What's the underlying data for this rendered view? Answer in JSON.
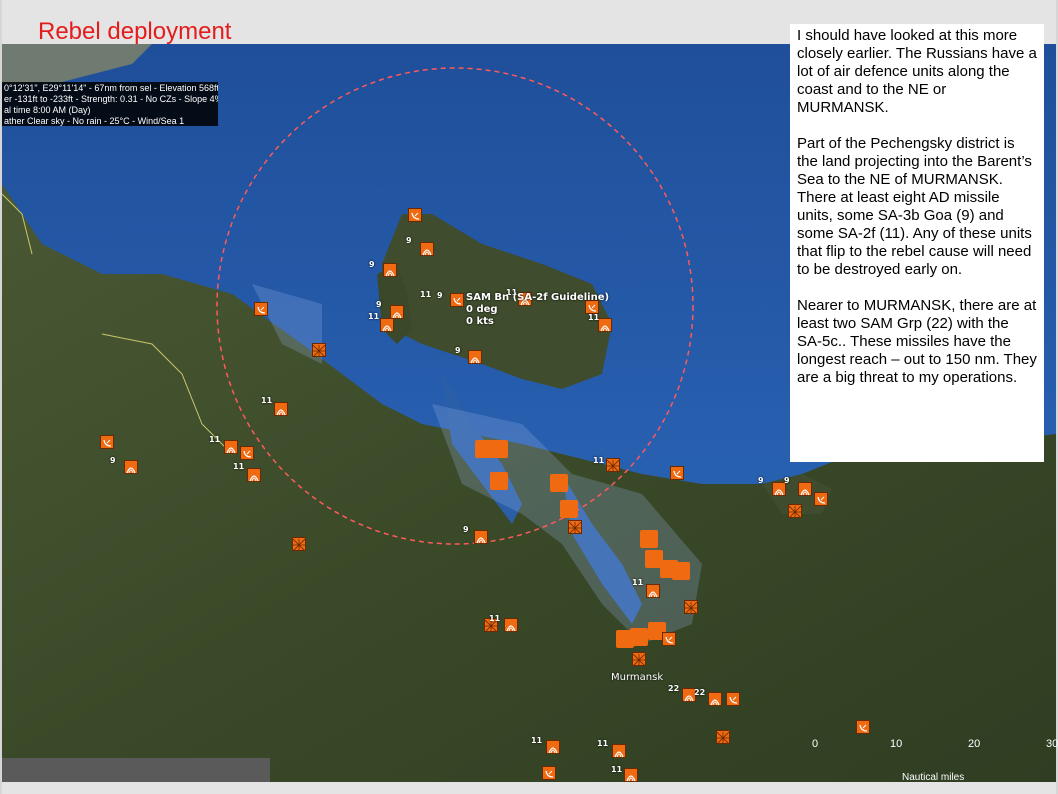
{
  "slide": {
    "title": "Rebel deployment",
    "title_color": "#e51c1c"
  },
  "info_panel": {
    "line1": "0°12'31\", E29°11'14\" - 67nm from sel - Elevation 568ft",
    "line2": "er -131ft to -233ft - Strength: 0.31 - No CZs - Slope 4%",
    "line3": "al time 8:00 AM (Day)",
    "line4": "ather Clear sky - No rain - 25°C - Wind/Sea 1"
  },
  "note": {
    "p1": "I should have looked at this more closely earlier.  The Russians have a lot of air defence units along the coast and to the NE or MURMANSK.",
    "p2": "Part of the Pechengsky district is the land projecting into the Barent’s Sea to the NE of MURMANSK.  There at least eight AD missile units, some SA-3b Goa (9) and some SA-2f (11).  Any of these units that flip to the rebel cause will need to be destroyed early on.",
    "p3": "Nearer to MURMANSK, there are at least two SAM Grp (22) with the SA-5c..  These missiles have the longest reach – out to 150 nm.  They are a big threat to my operations."
  },
  "selected_unit": {
    "name": "SAM Bn (SA-2f Guideline)",
    "heading": "0 deg",
    "speed": "0 kts"
  },
  "map": {
    "city_label": "Murmansk",
    "unit_color": "#f06a12",
    "range_ring_color": "#ff5a5a",
    "sea_color": "#2a5fa8",
    "land_color": "#3d4a2b",
    "unit_labels": [
      "9",
      "9",
      "9",
      "11",
      "9",
      "11",
      "11",
      "9",
      "11",
      "11",
      "9",
      "11",
      "9",
      "11",
      "9",
      "9",
      "11",
      "22",
      "22",
      "11",
      "11",
      "11",
      "11",
      "11"
    ]
  },
  "scale_bar": {
    "ticks": [
      "0",
      "10",
      "20",
      "30"
    ],
    "unit": "Nautical miles"
  }
}
